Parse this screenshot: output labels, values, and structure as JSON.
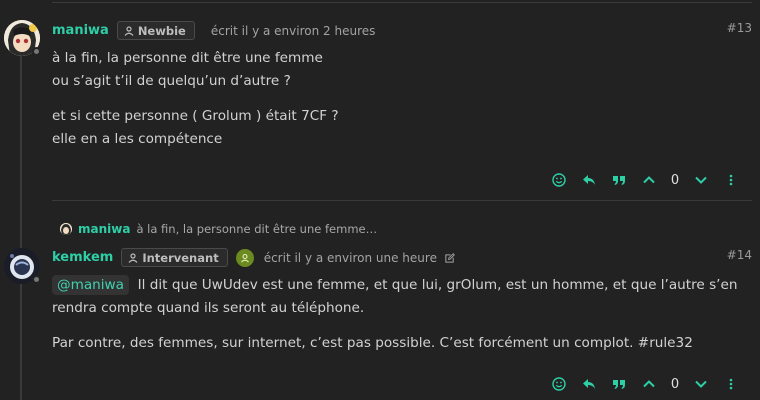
{
  "posts": [
    {
      "username": "maniwa",
      "badge": "Newbie",
      "posted": "écrit il y a environ 2 heures",
      "number": "#13",
      "paragraphs": [
        "à la fin, la personne dit être une femme\nou s’agit t’il de quelqu’un d’autre ?",
        "et si cette personne ( Grolum ) était 7CF ?\nelle en a les compétence"
      ],
      "votes": "0"
    },
    {
      "reply_to_user": "maniwa",
      "reply_to_excerpt": "à la fin, la personne dit être une femme…",
      "username": "kemkem",
      "badge": "Intervenant",
      "posted": "écrit il y a environ une heure",
      "number": "#14",
      "mention": "@maniwa",
      "paragraph1": "Il dit que UwUdev est une femme, et que lui, grOlum, est un homme, et que l’autre s’en rendra compte quand ils seront au téléphone.",
      "paragraph2": "Par contre, des femmes, sur internet, c’est pas possible. C’est forcément un complot. #rule32",
      "votes": "0"
    }
  ],
  "icons": {
    "badge": "user-icon",
    "group": "group-icon",
    "edited": "edit-icon",
    "react": "smile-icon",
    "reply": "reply-icon",
    "quote": "quote-icon",
    "upvote": "chevron-up-icon",
    "downvote": "chevron-down-icon",
    "more": "more-vertical-icon"
  },
  "colors": {
    "accent": "#2ecfa7",
    "background": "#222222",
    "text": "#d2d2d2",
    "muted": "#a3a3a3"
  }
}
